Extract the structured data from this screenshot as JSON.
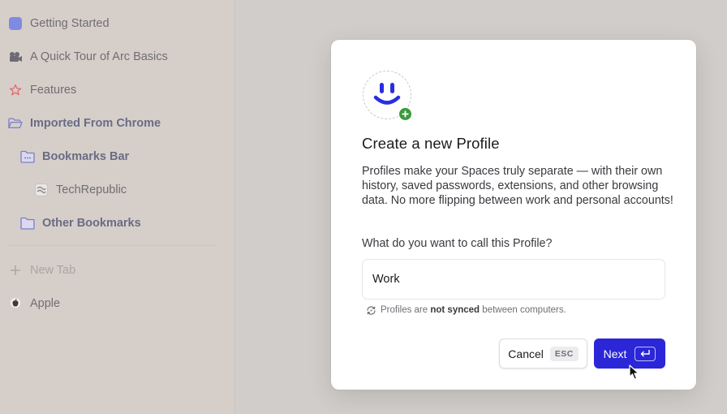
{
  "sidebar": {
    "items": [
      {
        "label": "Getting Started",
        "icon": "square-icon"
      },
      {
        "label": "A Quick Tour of Arc Basics",
        "icon": "video-camera-icon"
      },
      {
        "label": "Features",
        "icon": "star-icon"
      },
      {
        "label": "Imported From Chrome",
        "icon": "folder-open-icon"
      },
      {
        "label": "Bookmarks Bar",
        "icon": "folder-icon"
      },
      {
        "label": "TechRepublic",
        "icon": "techrepublic-favicon-icon"
      },
      {
        "label": "Other Bookmarks",
        "icon": "folder-icon"
      },
      {
        "label": "New Tab",
        "icon": "plus-icon"
      },
      {
        "label": "Apple",
        "icon": "apple-icon"
      }
    ]
  },
  "dialog": {
    "title": "Create a new Profile",
    "description": "Profiles make your Spaces truly separate — with their own history, saved passwords, extensions, and other browsing data. No more flipping between work and personal accounts!",
    "question": "What do you want to call this Profile?",
    "input_value": "Work",
    "note_prefix": "Profiles are ",
    "note_bold": "not synced",
    "note_suffix": " between computers.",
    "cancel_label": "Cancel",
    "cancel_key": "ESC",
    "next_label": "Next"
  },
  "colors": {
    "accent": "#2b26d8",
    "sidebar_bg": "#d6cfc9",
    "badge_green": "#3a9a3e",
    "square_icon": "#7f8be0"
  }
}
